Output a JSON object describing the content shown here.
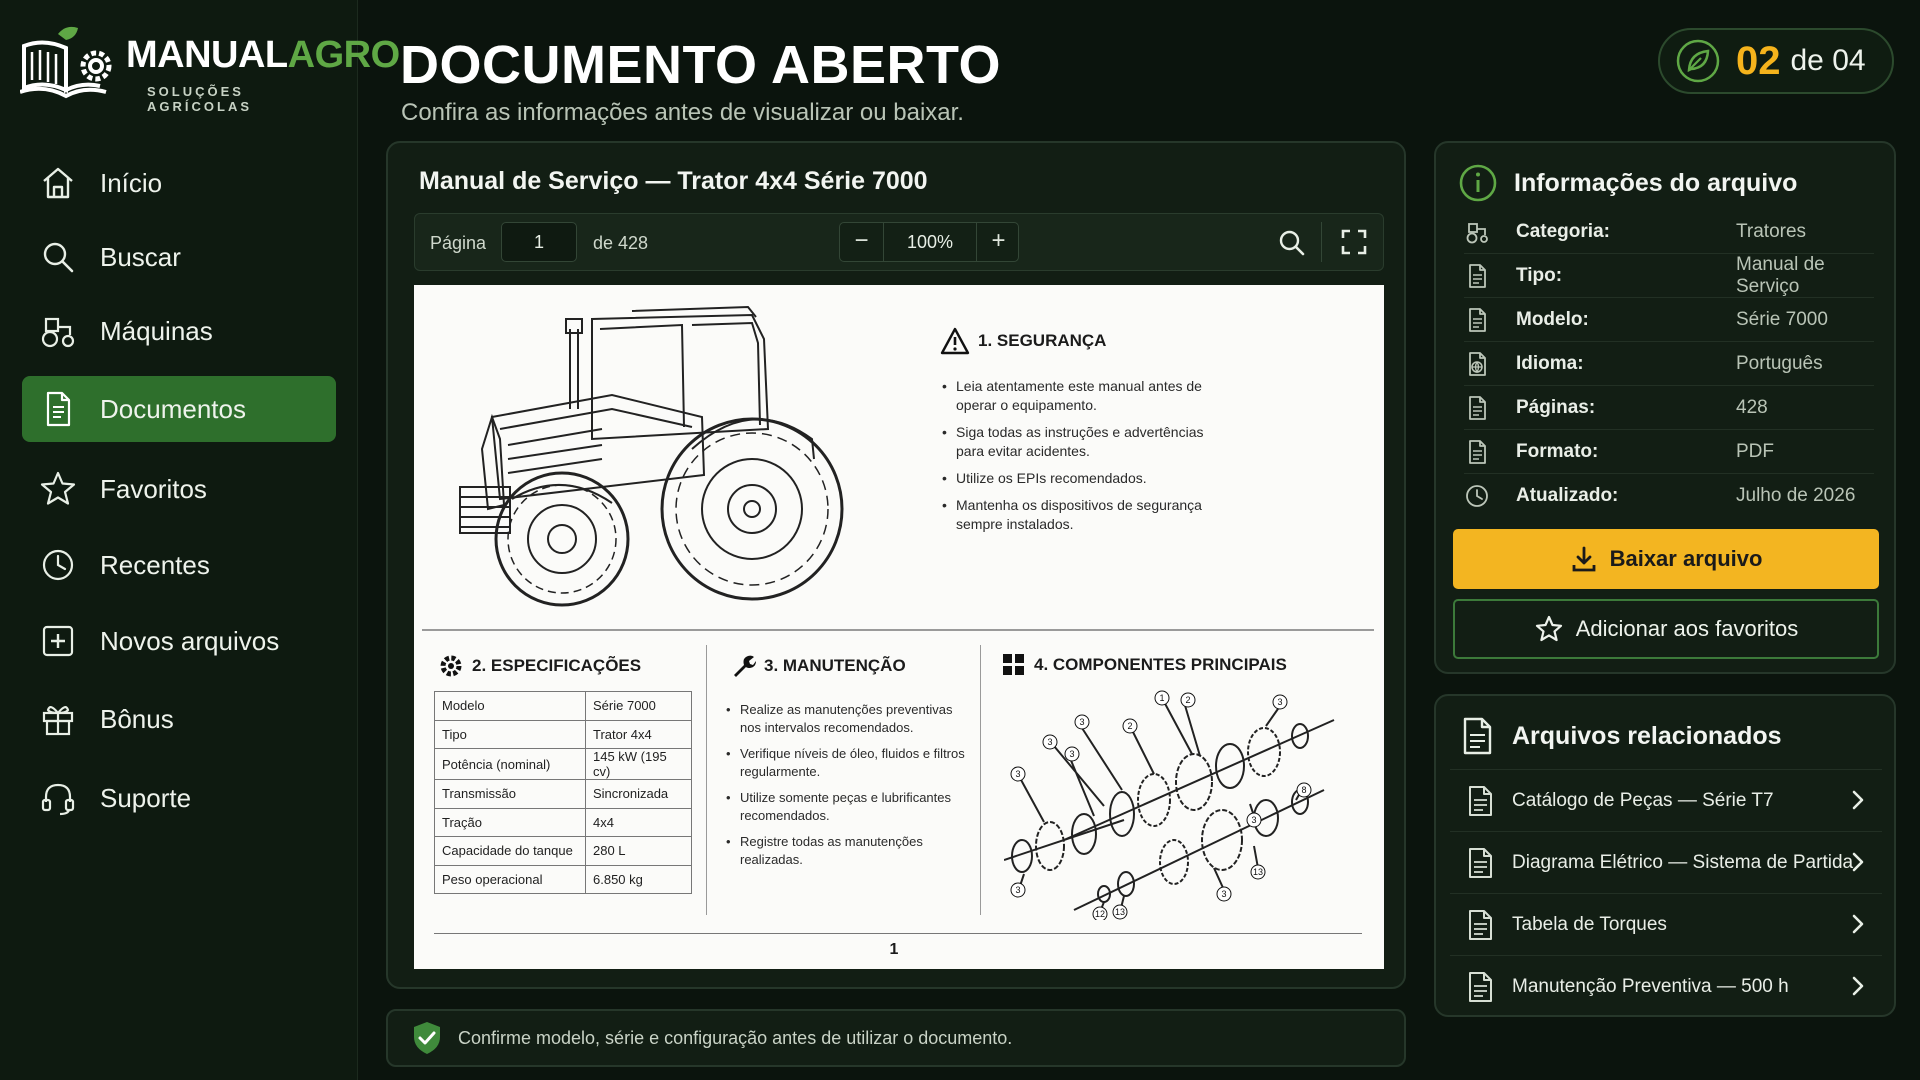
{
  "brand": {
    "name_part1": "MANUAL",
    "name_part2": "AGRO",
    "tagline": "SOLUÇÕES AGRÍCOLAS"
  },
  "nav": [
    {
      "label": "Início",
      "icon": "home-icon"
    },
    {
      "label": "Buscar",
      "icon": "search-icon"
    },
    {
      "label": "Máquinas",
      "icon": "tractor-icon"
    },
    {
      "label": "Documentos",
      "icon": "document-icon",
      "active": true
    },
    {
      "label": "Favoritos",
      "icon": "star-icon"
    },
    {
      "label": "Recentes",
      "icon": "clock-icon"
    },
    {
      "label": "Novos arquivos",
      "icon": "plus-square-icon"
    },
    {
      "label": "Bônus",
      "icon": "gift-icon"
    },
    {
      "label": "Suporte",
      "icon": "headset-icon"
    }
  ],
  "header": {
    "title": "DOCUMENTO ABERTO",
    "subtitle": "Confira as informações antes de visualizar ou baixar.",
    "step_current": "02",
    "step_total": "de 04"
  },
  "viewer": {
    "doc_title": "Manual de Serviço — Trator 4x4 Série 7000",
    "page_label": "Página",
    "page_value": "1",
    "page_total": "de 428",
    "zoom": "100%",
    "zoom_minus": "−",
    "zoom_plus": "+"
  },
  "document_page": {
    "safety": {
      "title": "1. SEGURANÇA",
      "bullets": [
        "Leia atentamente este manual antes de operar o equipamento.",
        "Siga todas as instruções e advertências para evitar acidentes.",
        "Utilize os EPIs recomendados.",
        "Mantenha os dispositivos de segurança sempre instalados."
      ]
    },
    "specs": {
      "title": "2. ESPECIFICAÇÕES",
      "rows": [
        [
          "Modelo",
          "Série 7000"
        ],
        [
          "Tipo",
          "Trator 4x4"
        ],
        [
          "Potência (nominal)",
          "145 kW (195 cv)"
        ],
        [
          "Transmissão",
          "Sincronizada"
        ],
        [
          "Tração",
          "4x4"
        ],
        [
          "Capacidade do tanque",
          "280 L"
        ],
        [
          "Peso operacional",
          "6.850 kg"
        ]
      ]
    },
    "maintenance": {
      "title": "3. MANUTENÇÃO",
      "bullets": [
        "Realize as manutenções preventivas nos intervalos recomendados.",
        "Verifique níveis de óleo, fluidos e filtros regularmente.",
        "Utilize somente peças e lubrificantes recomendados.",
        "Registre todas as manutenções realizadas."
      ]
    },
    "components": {
      "title": "4. COMPONENTES PRINCIPAIS",
      "callouts": [
        "1",
        "2",
        "3",
        "8",
        "12",
        "13"
      ]
    },
    "page_number": "1"
  },
  "notice": "Confirme modelo, série e configuração antes de utilizar o documento.",
  "info": {
    "title": "Informações do arquivo",
    "rows": [
      {
        "key": "Categoria:",
        "value": "Tratores",
        "icon": "tractor-icon"
      },
      {
        "key": "Tipo:",
        "value": "Manual de Serviço",
        "icon": "document-icon"
      },
      {
        "key": "Modelo:",
        "value": "Série 7000",
        "icon": "document-icon"
      },
      {
        "key": "Idioma:",
        "value": "Português",
        "icon": "globe-document-icon"
      },
      {
        "key": "Páginas:",
        "value": "428",
        "icon": "document-icon"
      },
      {
        "key": "Formato:",
        "value": "PDF",
        "icon": "document-icon"
      },
      {
        "key": "Atualizado:",
        "value": "Julho de 2026",
        "icon": "clock-icon"
      }
    ],
    "download_label": "Baixar arquivo",
    "favorite_label": "Adicionar aos favoritos"
  },
  "related": {
    "title": "Arquivos relacionados",
    "items": [
      "Catálogo de Peças — Série T7",
      "Diagrama Elétrico — Sistema de Partida",
      "Tabela de Torques",
      "Manutenção Preventiva — 500 h"
    ]
  },
  "colors": {
    "accent_green": "#2e6f2c",
    "accent_yellow": "#f3b521",
    "background": "#0b140d"
  }
}
